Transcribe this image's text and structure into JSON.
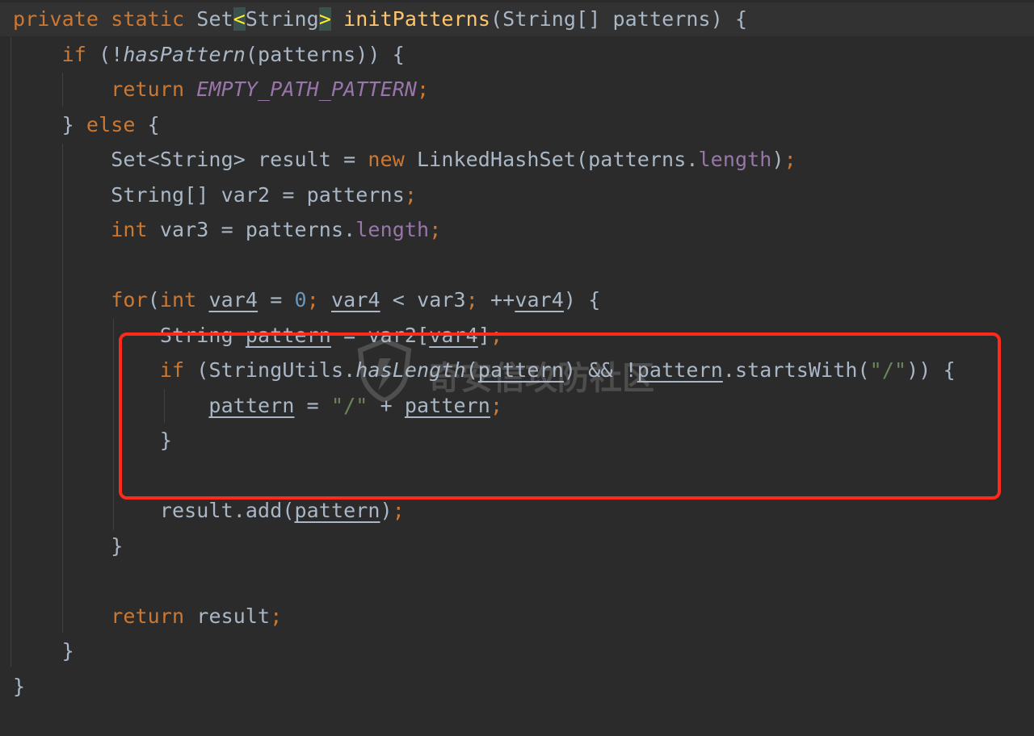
{
  "code": {
    "line1": {
      "private": "private",
      "static": "static",
      "set": "Set",
      "lt": "<",
      "string": "String",
      "gt": ">",
      "name": "initPatterns",
      "params": "(String[] patterns) {"
    },
    "line2": {
      "if": "if",
      "open": " (!",
      "call": "hasPattern",
      "rest": "(patterns)) {"
    },
    "line3": {
      "return": "return",
      "const": "EMPTY_PATH_PATTERN",
      "semi": ";"
    },
    "line4": {
      "brace": "}",
      "else": "else",
      "open": " {"
    },
    "line5": {
      "a": "Set<String> result = ",
      "new": "new",
      "b": " LinkedHashSet(patterns.",
      "field": "length",
      "c": ")",
      "semi": ";"
    },
    "line6": {
      "a": "String[] var2 = patterns",
      "semi": ";"
    },
    "line7": {
      "int": "int",
      "a": " var3 = patterns.",
      "field": "length",
      "semi": ";"
    },
    "line8": {
      "for": "for",
      "p1": "(",
      "int": "int",
      "v1": "var4",
      "eq": " = ",
      "zero": "0",
      "s1": ";",
      "v2": "var4",
      "lt": " < var3",
      "s2": ";",
      "inc": " ++",
      "v3": "var4",
      "close": ") {"
    },
    "line9": {
      "a": "String ",
      "var": "pattern",
      "b": " = var2[",
      "idx": "var4",
      "c": "]",
      "semi": ";"
    },
    "line10": {
      "if": "if",
      "a": " (StringUtils.",
      "call": "hasLength",
      "p": "(",
      "v1": "pattern",
      "b": ") && !",
      "v2": "pattern",
      "c": ".startsWith(",
      "str": "\"/\"",
      "d": ")) {"
    },
    "line11": {
      "v1": "pattern",
      "eq": " = ",
      "str": "\"/\"",
      "plus": " + ",
      "v2": "pattern",
      "semi": ";"
    },
    "line12": {
      "brace": "}"
    },
    "line13": {
      "a": "result.add(",
      "v": "pattern",
      "b": ")",
      "semi": ";"
    },
    "line14": {
      "brace": "}"
    },
    "line15": {
      "return": "return",
      "a": " result",
      "semi": ";"
    },
    "line16": {
      "brace": "}"
    },
    "line17": {
      "brace": "}"
    }
  },
  "watermark": {
    "text": "奇安信攻防社区"
  },
  "colors": {
    "background": "#2b2b2b",
    "keyword": "#cc7832",
    "method": "#ffc66d",
    "field": "#9876aa",
    "number": "#6897bb",
    "string": "#6a8759",
    "highlight_box": "#ff2a1a"
  }
}
